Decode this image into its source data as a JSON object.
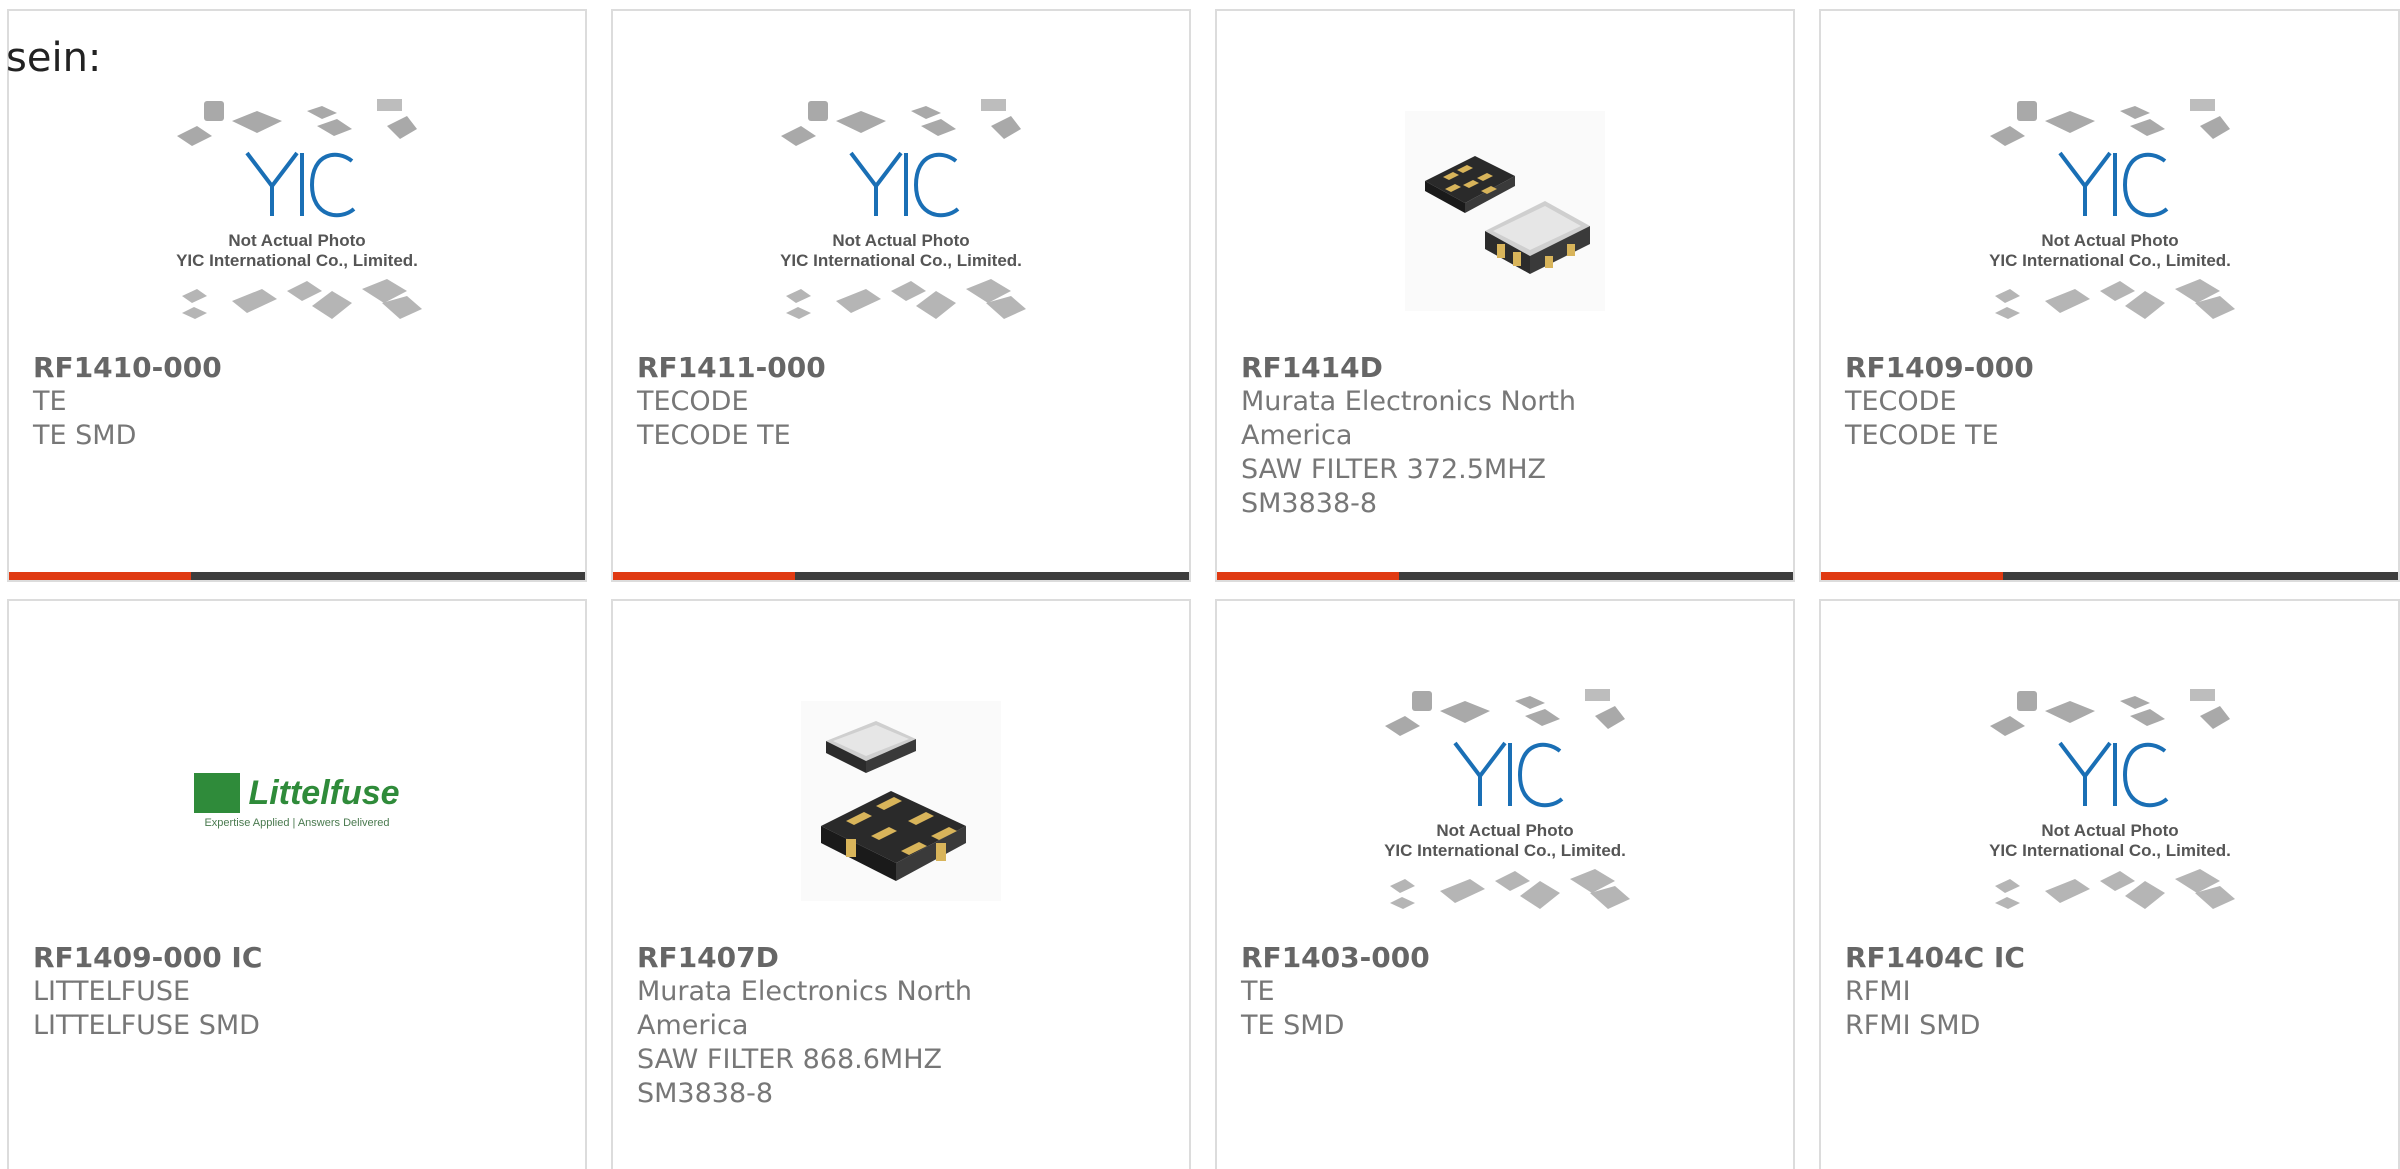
{
  "intro_text": "sein:",
  "placeholder": {
    "line1": "Not Actual Photo",
    "line2": "YIC International Co., Limited.",
    "logo_text": "YIC"
  },
  "littelfuse_logo": {
    "name": "Littelfuse",
    "tagline": "Expertise Applied | Answers Delivered"
  },
  "colors": {
    "accent": "#e03a12",
    "bar": "#3d3d3d",
    "yic_blue": "#1a6fb5",
    "littelfuse_green": "#2f8b3a"
  },
  "products": [
    {
      "part": "RF1410-000",
      "maker": "TE",
      "desc": "TE SMD",
      "image": "yic-placeholder"
    },
    {
      "part": "RF1411-000",
      "maker": "TECODE",
      "desc": "TECODE TE",
      "image": "yic-placeholder"
    },
    {
      "part": "RF1414D",
      "maker": "Murata Electronics North America",
      "desc": "SAW FILTER 372.5MHZ SM3838-8",
      "image": "saw-filter-chip"
    },
    {
      "part": "RF1409-000",
      "maker": "TECODE",
      "desc": "TECODE TE",
      "image": "yic-placeholder"
    },
    {
      "part": "RF1409-000 IC",
      "maker": "LITTELFUSE",
      "desc": "LITTELFUSE SMD",
      "image": "littelfuse-logo"
    },
    {
      "part": "RF1407D",
      "maker": "Murata Electronics North America",
      "desc": "SAW FILTER 868.6MHZ SM3838-8",
      "image": "saw-filter-chip-alt"
    },
    {
      "part": "RF1403-000",
      "maker": "TE",
      "desc": "TE SMD",
      "image": "yic-placeholder"
    },
    {
      "part": "RF1404C IC",
      "maker": "RFMI",
      "desc": "RFMI SMD",
      "image": "yic-placeholder"
    }
  ]
}
